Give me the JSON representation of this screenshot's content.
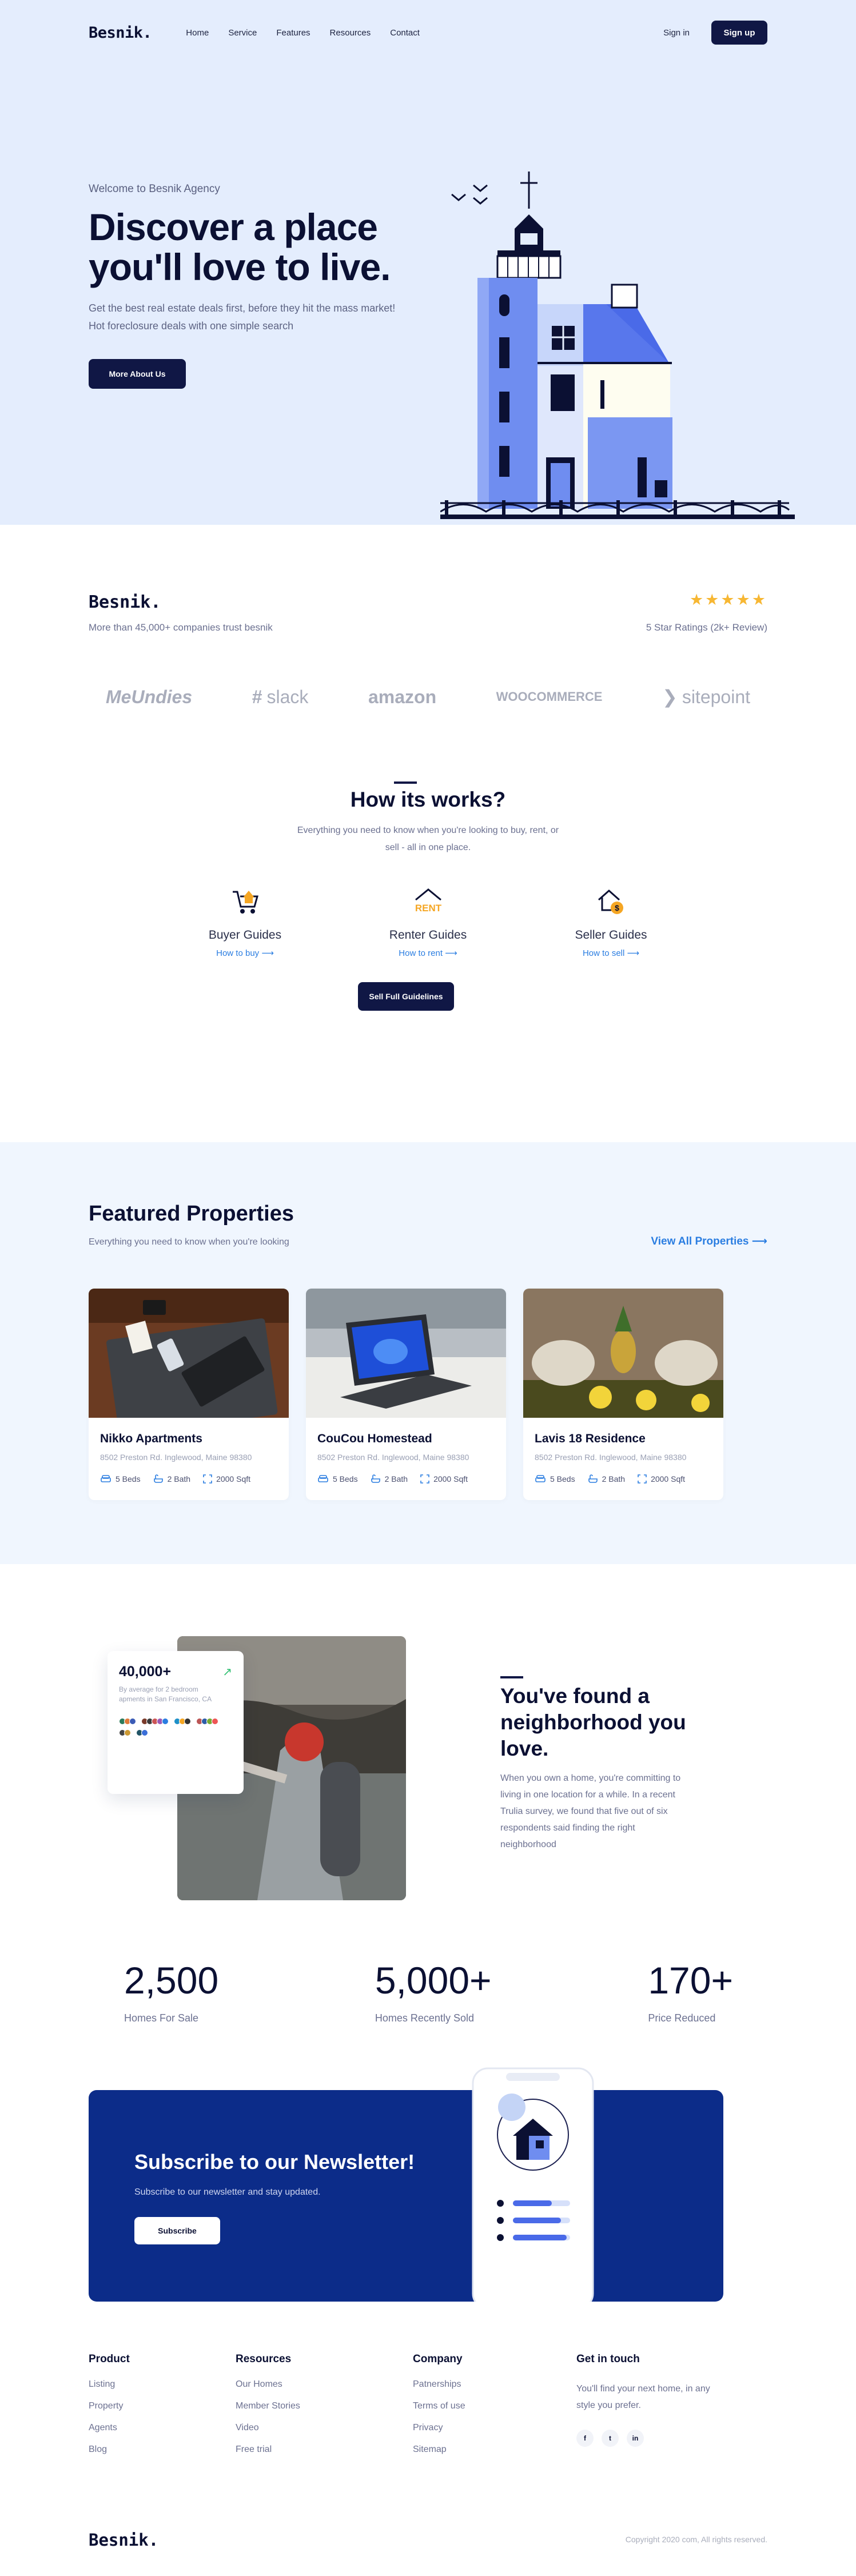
{
  "nav": {
    "logo": "Besnik.",
    "links": [
      "Home",
      "Service",
      "Features",
      "Resources",
      "Contact"
    ],
    "signin": "Sign in",
    "signup": "Sign up"
  },
  "hero": {
    "eyebrow": "Welcome to Besnik Agency",
    "title": "Discover a place you'll love to live.",
    "subtitle": "Get the best real estate deals first, before they hit the mass market! Hot foreclosure deals with one simple search",
    "button": "More About Us"
  },
  "trust": {
    "logo": "Besnik.",
    "note": "More than 45,000+ companies trust besnik",
    "stars": "★★★★★",
    "rating": "5 Star Ratings (2k+ Review)",
    "brands": [
      "MeUndies",
      "slack",
      "amazon",
      "WOOCOMMERCE",
      "sitepoint"
    ]
  },
  "how": {
    "title": "How its works?",
    "subtitle": "Everything you need to know when you're looking to buy, rent, or sell - all in one place.",
    "guides": [
      {
        "title": "Buyer Guides",
        "link": "How to buy",
        "icon": "cart-house-icon"
      },
      {
        "title": "Renter Guides",
        "link": "How to rent",
        "icon": "rent-icon"
      },
      {
        "title": "Seller Guides",
        "link": "How to sell",
        "icon": "house-dollar-icon"
      }
    ],
    "button": "Sell Full Guidelines",
    "accent": "#f5a623"
  },
  "featured": {
    "title": "Featured Properties",
    "subtitle": "Everything you need to know when you're looking",
    "view_all": "View All Properties",
    "cards": [
      {
        "title": "Nikko Apartments",
        "address": "8502 Preston Rd. Inglewood, Maine 98380",
        "beds": "5 Beds",
        "baths": "2 Bath",
        "area": "2000 Sqft"
      },
      {
        "title": "CouCou Homestead",
        "address": "8502 Preston Rd. Inglewood, Maine 98380",
        "beds": "5 Beds",
        "baths": "2 Bath",
        "area": "2000 Sqft"
      },
      {
        "title": "Lavis 18 Residence",
        "address": "8502 Preston Rd. Inglewood, Maine 98380",
        "beds": "5 Beds",
        "baths": "2 Bath",
        "area": "2000 Sqft"
      }
    ]
  },
  "neighborhood": {
    "stat_num": "40,000+",
    "stat_desc": "By average for 2 bedroom apments in San Francisco, CA",
    "title": "You've found a neighborhood you love.",
    "text": "When you own a home, you're committing to living in one location for a while. In a recent Trulia survey, we found that five out of six respondents said finding the right neighborhood"
  },
  "stats": [
    {
      "value": "2,500",
      "label": "Homes For Sale"
    },
    {
      "value": "5,000+",
      "label": "Homes Recently Sold"
    },
    {
      "value": "170+",
      "label": "Price Reduced"
    }
  ],
  "newsletter": {
    "title": "Subscribe to our Newsletter!",
    "subtitle": "Subscribe to our newsletter and stay updated.",
    "button": "Subscribe",
    "bg": "#0c2c89"
  },
  "footer": {
    "columns": [
      {
        "title": "Product",
        "items": [
          "Listing",
          "Property",
          "Agents",
          "Blog"
        ]
      },
      {
        "title": "Resources",
        "items": [
          "Our Homes",
          "Member Stories",
          "Video",
          "Free trial"
        ]
      },
      {
        "title": "Company",
        "items": [
          "Patnerships",
          "Terms of use",
          "Privacy",
          "Sitemap"
        ]
      }
    ],
    "touch_title": "Get in touch",
    "touch_text": "You'll find your next home, in any style you prefer.",
    "socials": [
      "f",
      "t",
      "in"
    ],
    "logo": "Besnik.",
    "copyright": "Copyright 2020 com, All rights reserved."
  }
}
